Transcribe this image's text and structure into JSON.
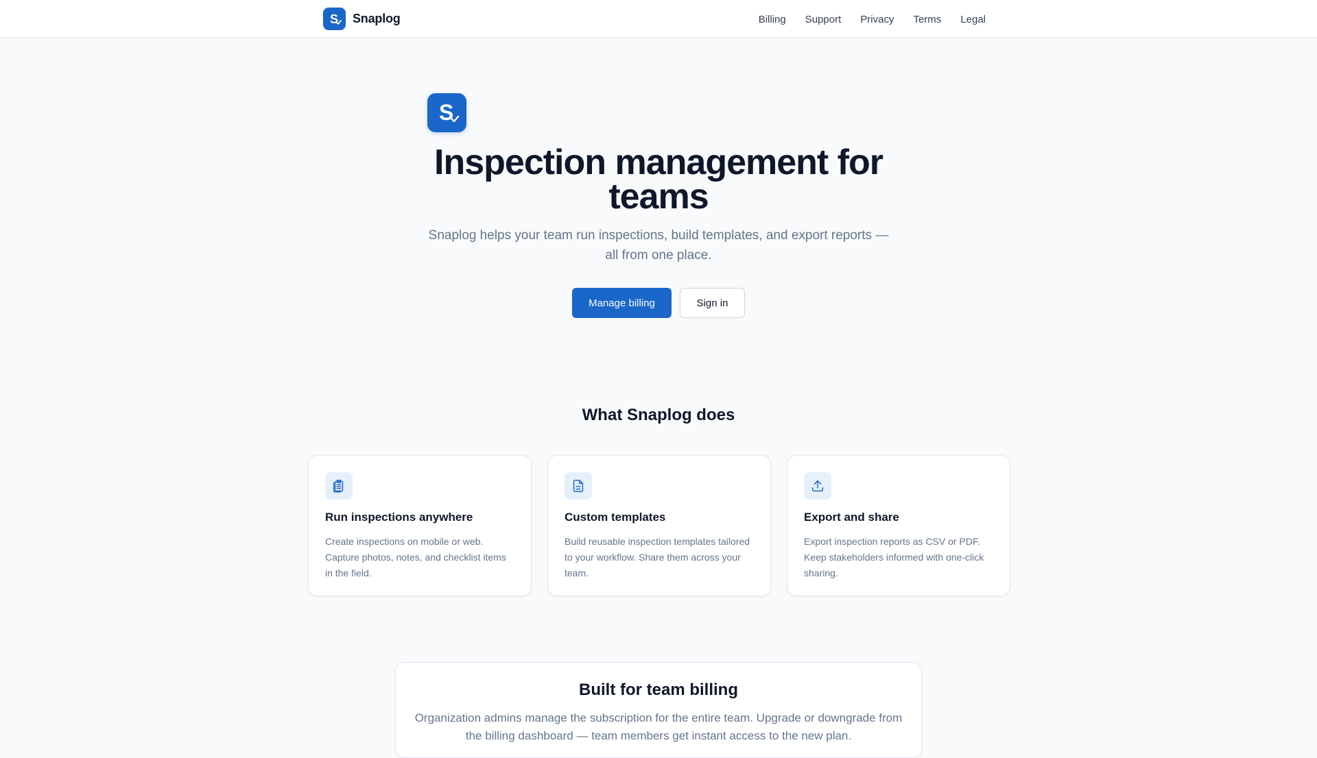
{
  "header": {
    "brand_name": "Snaplog",
    "nav": [
      {
        "label": "Billing"
      },
      {
        "label": "Support"
      },
      {
        "label": "Privacy"
      },
      {
        "label": "Terms"
      },
      {
        "label": "Legal"
      }
    ]
  },
  "hero": {
    "title": "Inspection management for teams",
    "subtitle": "Snaplog helps your team run inspections, build templates, and export reports — all from one place.",
    "primary_cta": "Manage billing",
    "secondary_cta": "Sign in"
  },
  "features": {
    "title": "What Snaplog does",
    "items": [
      {
        "icon": "clipboard-icon",
        "title": "Run inspections anywhere",
        "text": "Create inspections on mobile or web. Capture photos, notes, and checklist items in the field."
      },
      {
        "icon": "document-icon",
        "title": "Custom templates",
        "text": "Build reusable inspection templates tailored to your workflow. Share them across your team."
      },
      {
        "icon": "upload-icon",
        "title": "Export and share",
        "text": "Export inspection reports as CSV or PDF. Keep stakeholders informed with one-click sharing."
      }
    ]
  },
  "billing": {
    "title": "Built for team billing",
    "text": "Organization admins manage the subscription for the entire team. Upgrade or downgrade from the billing dashboard — team members get instant access to the new plan."
  },
  "colors": {
    "brand": "#1a66c9",
    "icon_bg": "#e6f0fb",
    "muted_text": "#64748b",
    "page_bg": "#f8fafc"
  }
}
